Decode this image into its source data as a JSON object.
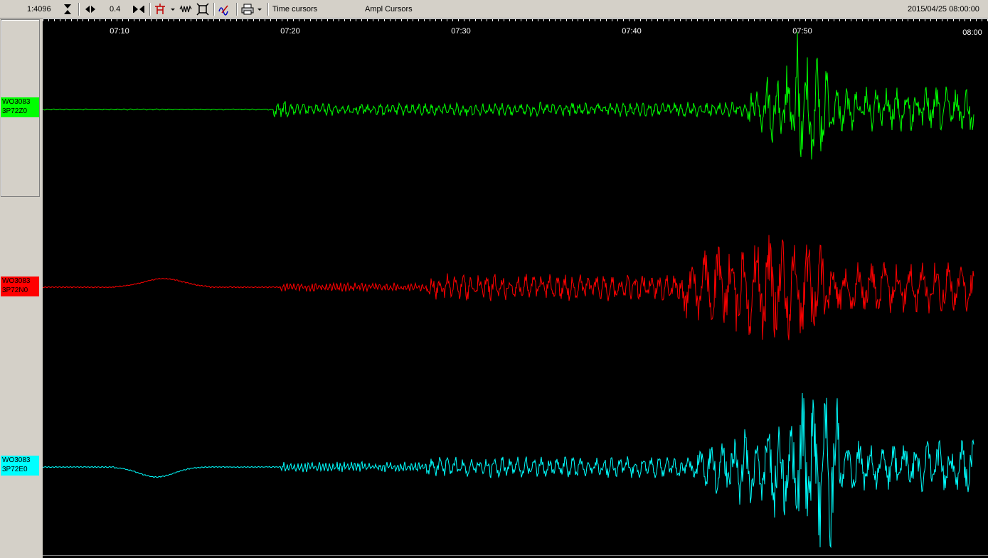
{
  "toolbar": {
    "scale": "1:4096",
    "gain": "0.4",
    "time_cursors_label": "Time cursors",
    "ampl_cursors_label": "Ampl Cursors",
    "datetime": "2015/04/25 08:00:00",
    "icons": [
      "zoom-vertical-icon",
      "pan-horizontal-icon",
      "fit-horizontal-icon",
      "filter-icon",
      "dropdown-arrow-icon",
      "waveform-icon",
      "fit-window-icon",
      "spectrum-icon",
      "print-icon",
      "dropdown-arrow-icon"
    ]
  },
  "time_axis": {
    "ticks": [
      "07:10",
      "07:20",
      "07:30",
      "07:40",
      "07:50",
      "08:00"
    ]
  },
  "channels": [
    {
      "station": "WO3083",
      "component": "3P72Z0",
      "color": "#00ff00"
    },
    {
      "station": "WO3083",
      "component": "3P72N0",
      "color": "#ff0000"
    },
    {
      "station": "WO3083",
      "component": "3P72E0",
      "color": "#00ffff"
    }
  ],
  "colors": {
    "background": "#000000",
    "axis": "#ffffff",
    "panel": "#d4d0c8"
  }
}
